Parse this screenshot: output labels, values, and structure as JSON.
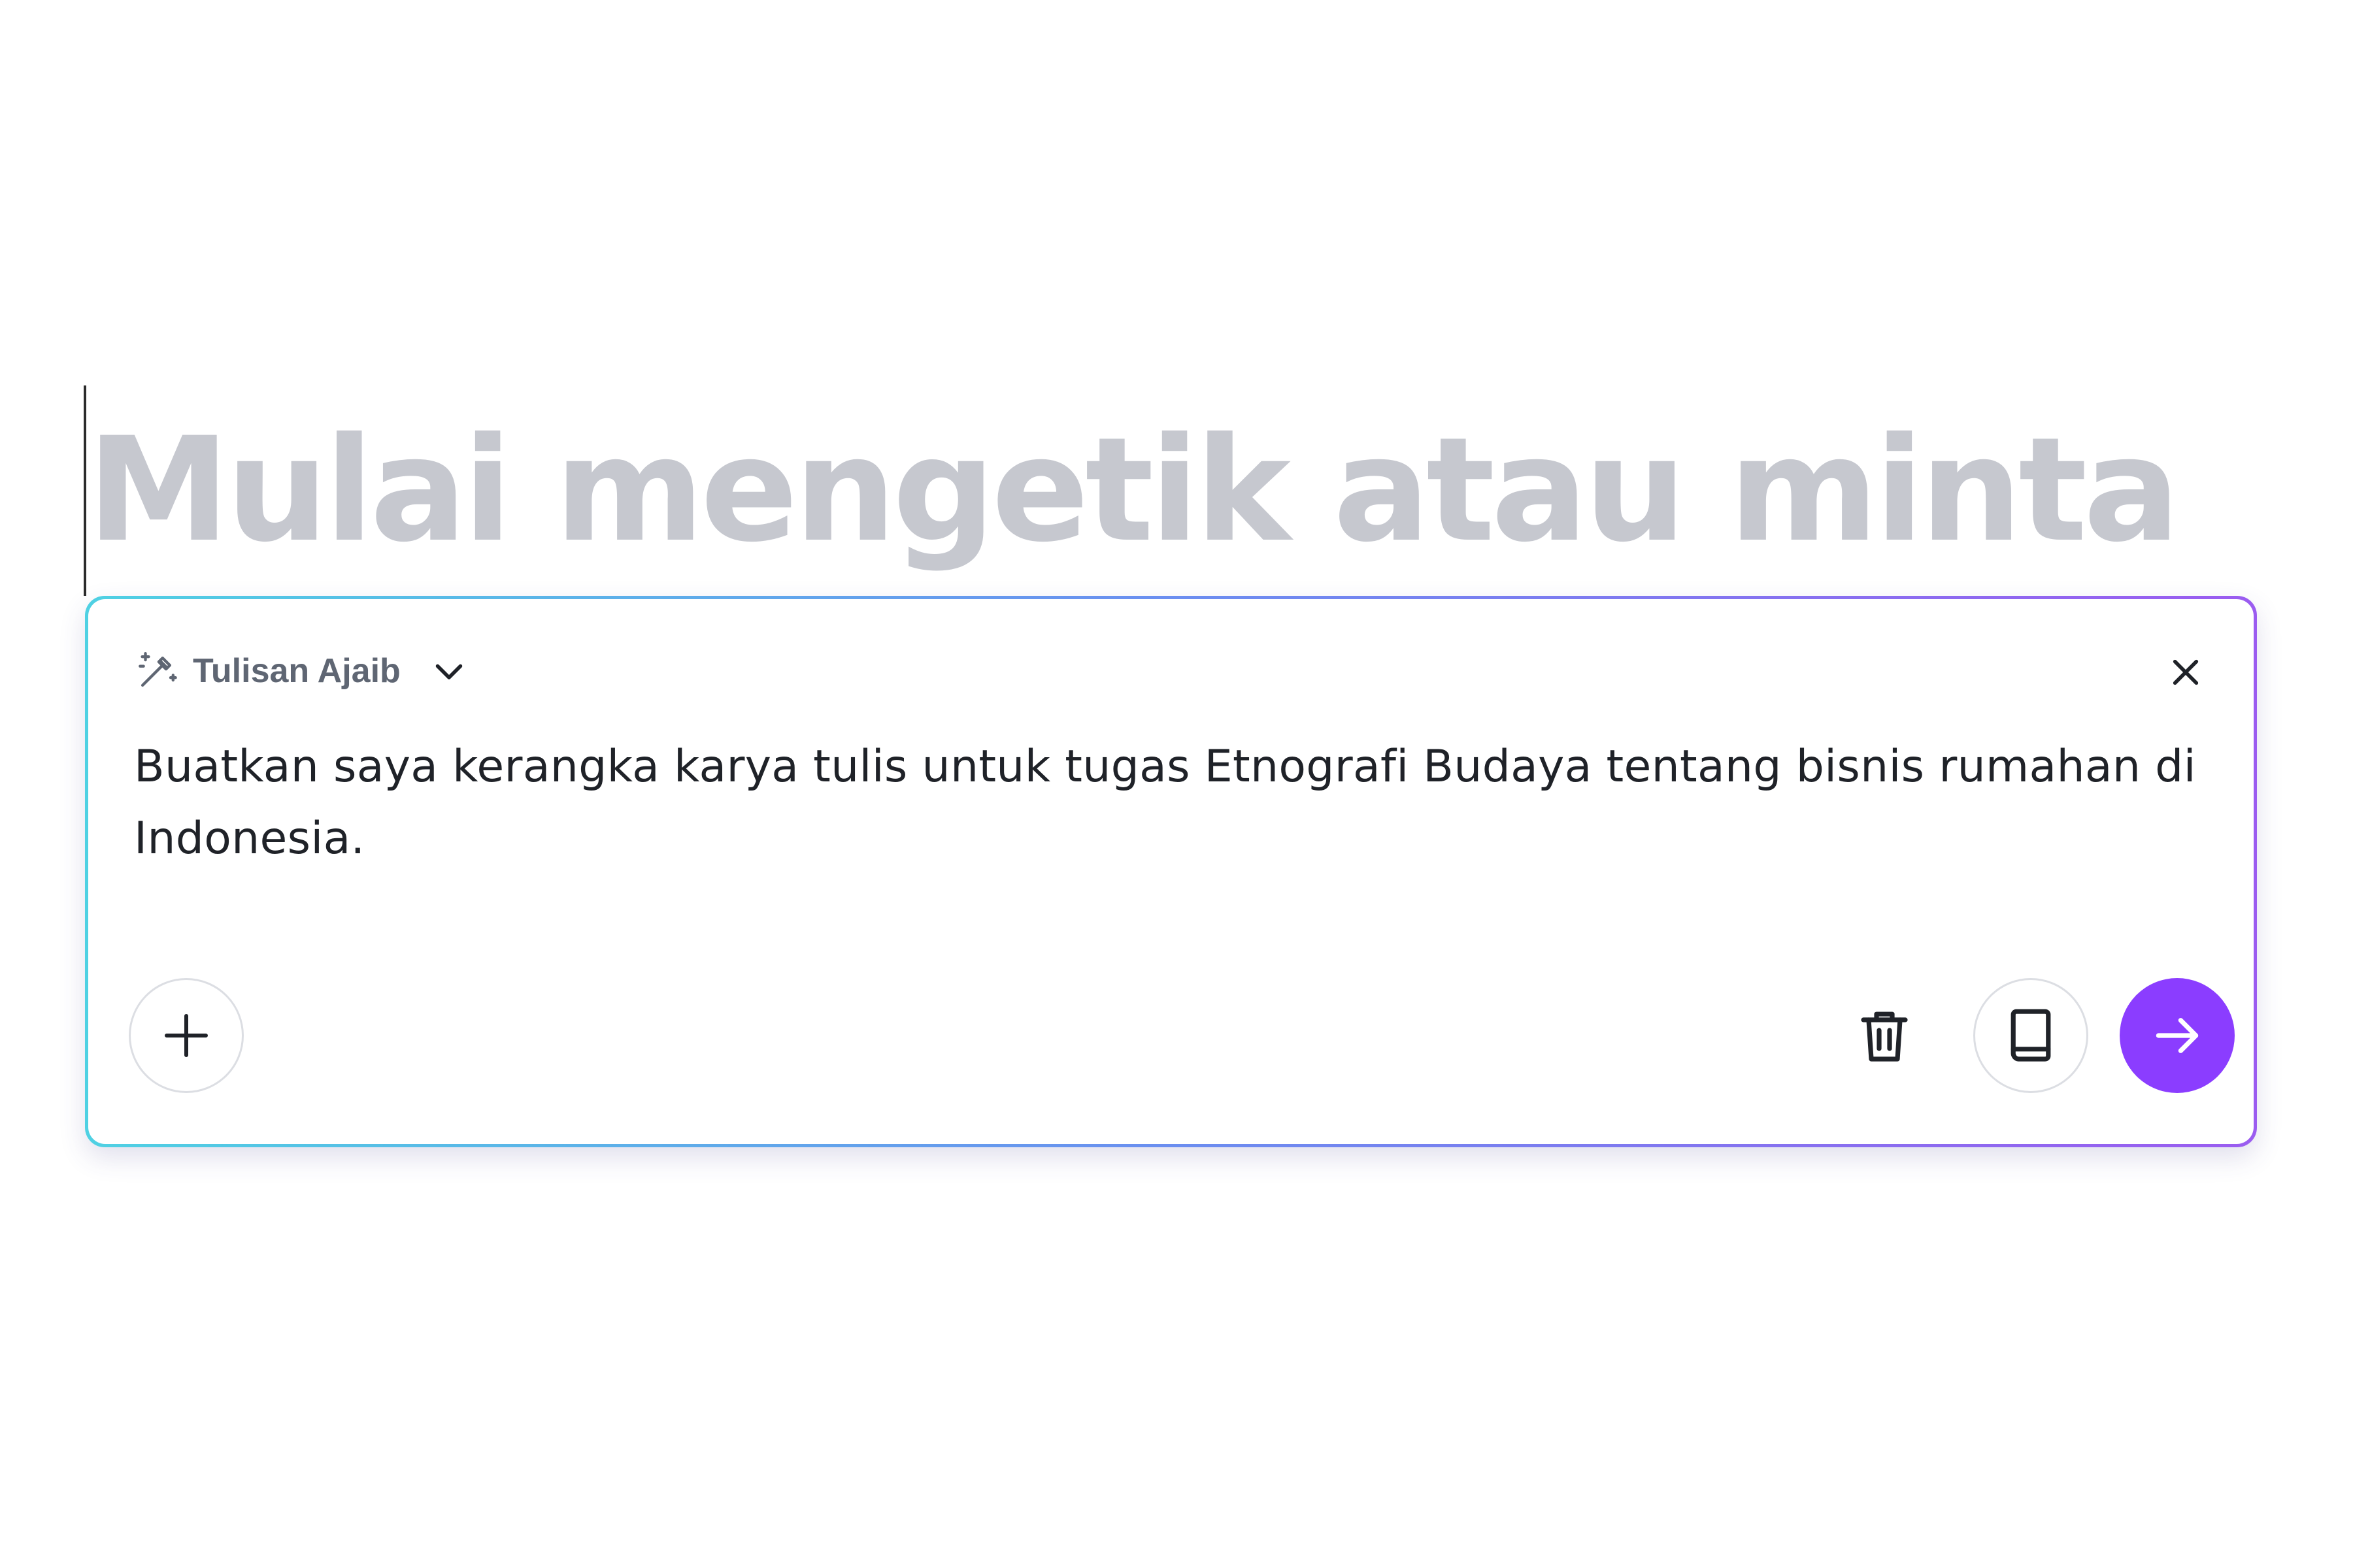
{
  "canvas": {
    "placeholder_text": "Mulai mengetik atau minta"
  },
  "magic_write": {
    "mode_label": "Tulisan Ajaib",
    "mode_icon": "magic-wand-icon",
    "prompt_text": "Buatkan saya kerangka karya tulis untuk tugas Etnografi Budaya tentang bisnis rumahan di Indonesia.",
    "actions": {
      "add_icon": "plus-icon",
      "delete_icon": "trash-icon",
      "library_icon": "book-icon",
      "send_icon": "arrow-right-icon",
      "close_icon": "close-icon"
    }
  },
  "colors": {
    "accent": "#8b3dff",
    "gradient_start": "#4fd1e3",
    "gradient_end": "#9b5cf0",
    "placeholder": "#c6c8cf"
  }
}
